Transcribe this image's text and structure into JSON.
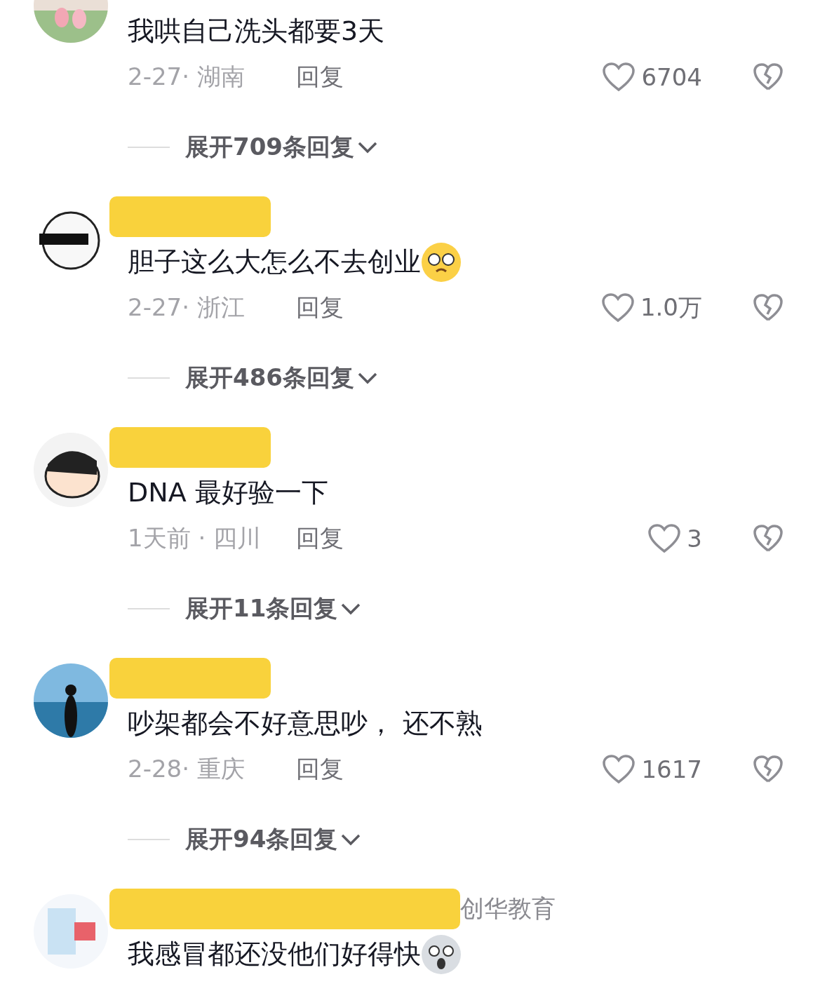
{
  "comments": [
    {
      "text": "我哄自己洗头都要3天",
      "emoji": false,
      "date": "2-27· 湖南",
      "reply": "回复",
      "likes": "6704",
      "expand": "展开709条回复"
    },
    {
      "name_redacted": true,
      "text": "胆子这么大怎么不去创业",
      "emoji": true,
      "date": "2-27· 浙江",
      "reply": "回复",
      "likes": "1.0万",
      "expand": "展开486条回复"
    },
    {
      "name_redacted": true,
      "text": "DNA 最好验一下",
      "emoji": false,
      "date": "1天前 · 四川",
      "reply": "回复",
      "likes": "3",
      "expand": "展开11条回复"
    },
    {
      "name_redacted": true,
      "text": "吵架都会不好意思吵， 还不熟",
      "emoji": false,
      "date": "2-28· 重庆",
      "reply": "回复",
      "likes": "1617",
      "expand": "展开94条回复"
    },
    {
      "name_redacted": true,
      "name_visible": "创华教育",
      "text": "我感冒都还没他们好得快",
      "emoji": true
    }
  ]
}
